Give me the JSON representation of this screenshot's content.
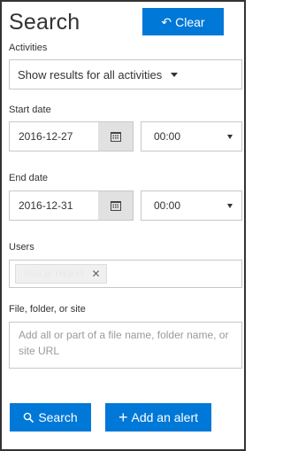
{
  "header": {
    "title": "Search",
    "clear_label": "Clear"
  },
  "activities": {
    "label": "Activities",
    "value": "Show results for all activities"
  },
  "start_date": {
    "label": "Start date",
    "date": "2016-12-27",
    "time": "00:00"
  },
  "end_date": {
    "label": "End date",
    "date": "2016-12-31",
    "time": "00:00"
  },
  "users": {
    "label": "Users",
    "chips": [
      "Brooks Nelson"
    ]
  },
  "target": {
    "label": "File, folder, or site",
    "placeholder": "Add all or part of a file name, folder name, or site URL"
  },
  "actions": {
    "search_label": "Search",
    "alert_label": "Add an alert"
  },
  "colors": {
    "accent": "#0078d7",
    "border": "#c8c8c8",
    "calendar_bg": "#e1e1e1"
  },
  "icons": {
    "clear": "undo-icon",
    "search": "search-icon",
    "alert": "plus-icon",
    "calendar": "calendar-icon"
  }
}
